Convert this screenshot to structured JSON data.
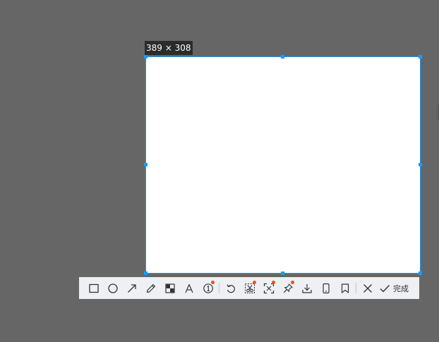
{
  "selection": {
    "size_label": "389 × 308"
  },
  "toolbar": {
    "tools": [
      {
        "name": "rectangle-icon"
      },
      {
        "name": "ellipse-icon"
      },
      {
        "name": "arrow-icon"
      },
      {
        "name": "pencil-icon"
      },
      {
        "name": "mosaic-icon"
      },
      {
        "name": "text-icon"
      },
      {
        "name": "number-marker-icon"
      },
      {
        "name": "undo-icon"
      },
      {
        "name": "scissors-icon"
      },
      {
        "name": "ocr-scan-icon"
      },
      {
        "name": "pin-icon"
      },
      {
        "name": "download-icon"
      },
      {
        "name": "phone-icon"
      },
      {
        "name": "bookmark-icon"
      },
      {
        "name": "close-icon"
      },
      {
        "name": "check-icon"
      }
    ],
    "done_label": "完成"
  },
  "colors": {
    "backdrop": "#666666",
    "selection_border": "#1a9bff",
    "toolbar_bg": "#eef0f4",
    "notification_dot": "#e8541a"
  }
}
